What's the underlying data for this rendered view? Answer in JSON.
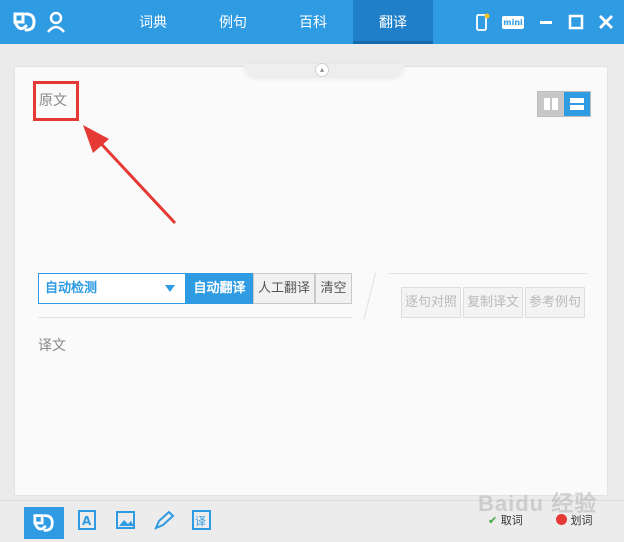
{
  "header": {
    "logo_text": "Ø",
    "tabs": [
      {
        "label": "词典",
        "active": false
      },
      {
        "label": "例句",
        "active": false
      },
      {
        "label": "百科",
        "active": false
      },
      {
        "label": "翻译",
        "active": true
      }
    ],
    "mini_label": "mini"
  },
  "panel": {
    "source_label": "原文",
    "target_label": "译文"
  },
  "toolbar": {
    "language_selected": "自动检测",
    "auto_translate": "自动翻译",
    "human_translate": "人工翻译",
    "clear": "清空",
    "sentence_compare": "逐句对照",
    "copy_translation": "复制译文",
    "reference_examples": "参考例句"
  },
  "statusbar": {
    "word_pick": "取词",
    "word_select": "划词"
  },
  "watermark": "Baidu 经验",
  "colors": {
    "brand": "#2f9be3",
    "highlight_box": "#e53935"
  }
}
